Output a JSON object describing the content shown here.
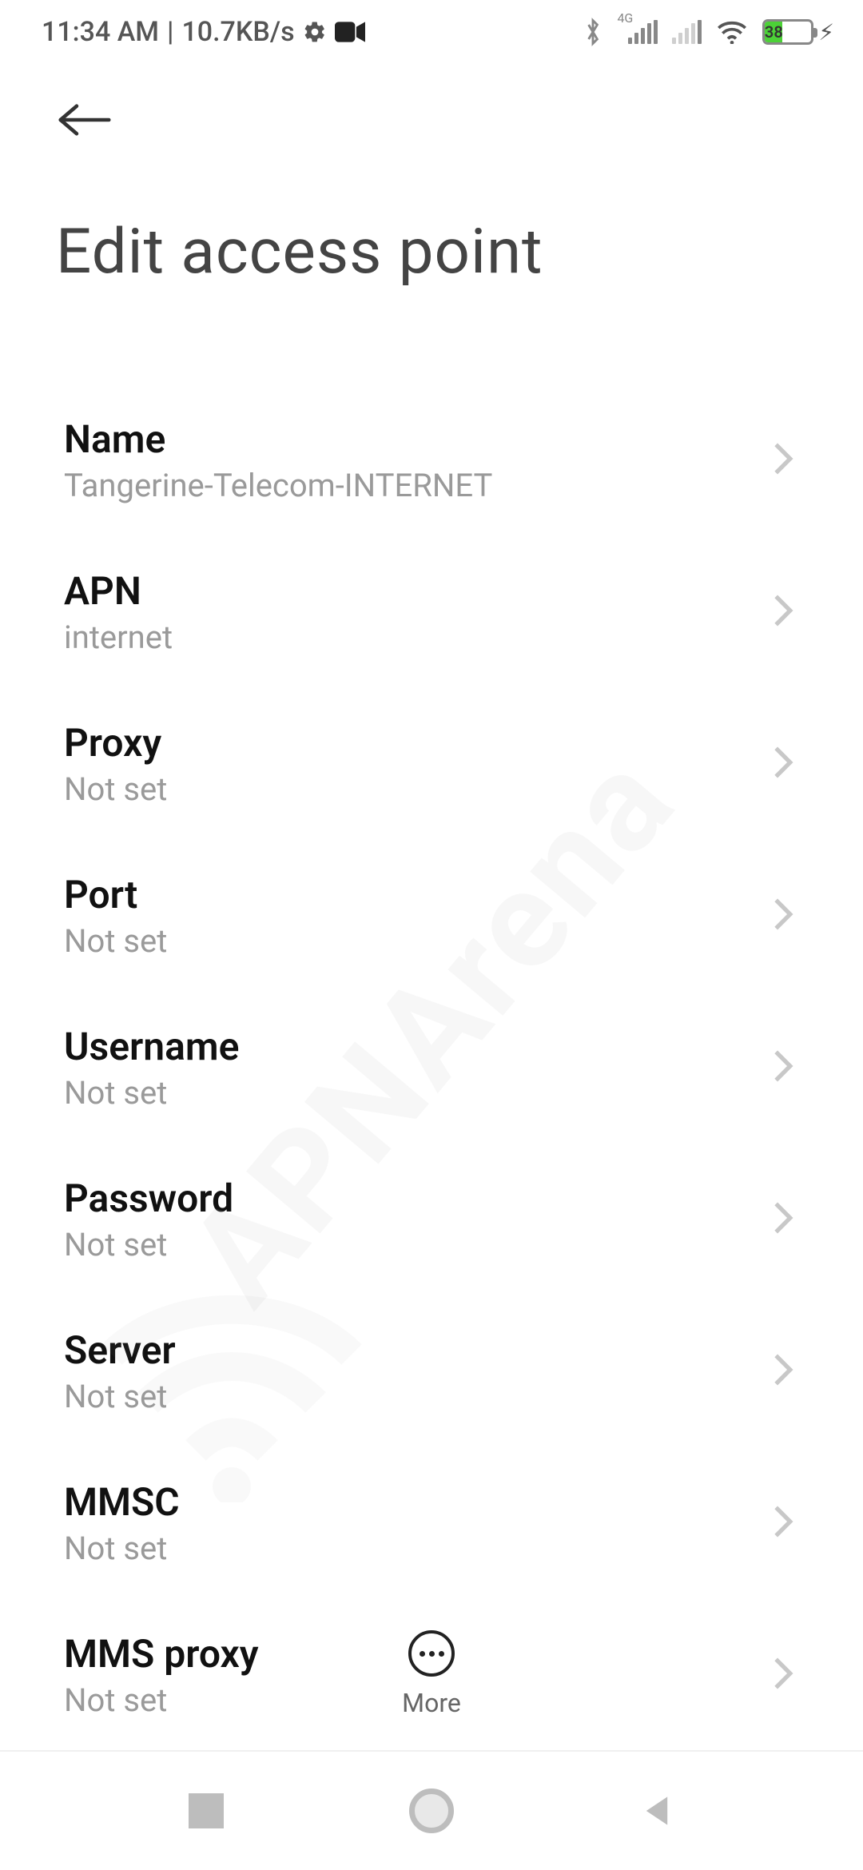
{
  "status": {
    "time": "11:34 AM",
    "net_speed": "10.7KB/s",
    "signal1_label": "4G",
    "battery_pct": "38",
    "battery_fill_pct": 38
  },
  "page": {
    "title": "Edit access point"
  },
  "settings": [
    {
      "label": "Name",
      "value": "Tangerine-Telecom-INTERNET"
    },
    {
      "label": "APN",
      "value": "internet"
    },
    {
      "label": "Proxy",
      "value": "Not set"
    },
    {
      "label": "Port",
      "value": "Not set"
    },
    {
      "label": "Username",
      "value": "Not set"
    },
    {
      "label": "Password",
      "value": "Not set"
    },
    {
      "label": "Server",
      "value": "Not set"
    },
    {
      "label": "MMSC",
      "value": "Not set"
    },
    {
      "label": "MMS proxy",
      "value": "Not set"
    }
  ],
  "bottom": {
    "more_label": "More"
  },
  "watermark": "APNArena"
}
